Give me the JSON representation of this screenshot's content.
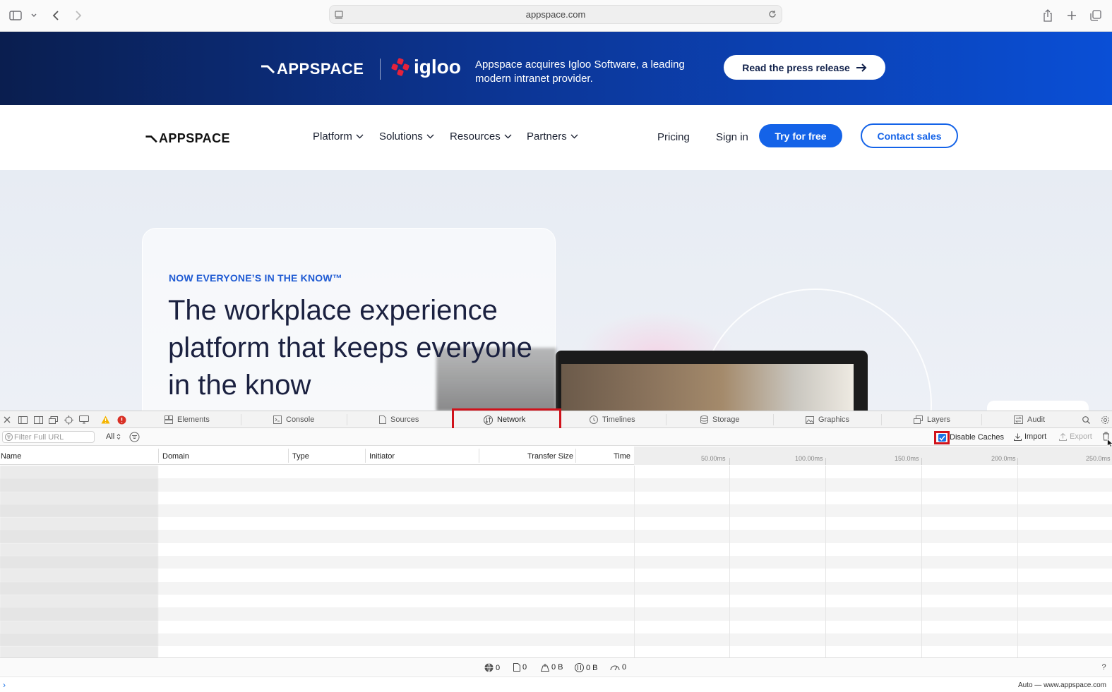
{
  "browser": {
    "url": "appspace.com"
  },
  "banner": {
    "logo_text": "APPSPACE",
    "partner_text": "igloo",
    "message": "Appspace acquires Igloo Software, a leading modern intranet provider.",
    "cta_label": "Read the press release"
  },
  "nav": {
    "brand": "APPSPACE",
    "menus": [
      "Platform",
      "Solutions",
      "Resources",
      "Partners"
    ],
    "pricing": "Pricing",
    "signin": "Sign in",
    "try_label": "Try for free",
    "contact_label": "Contact sales"
  },
  "hero": {
    "eyebrow": "NOW EVERYONE’S IN THE KNOW™",
    "headline": "The workplace experience platform that keeps everyone in the know"
  },
  "devtools": {
    "tabs": [
      "Elements",
      "Console",
      "Sources",
      "Network",
      "Timelines",
      "Storage",
      "Graphics",
      "Layers",
      "Audit"
    ],
    "active_tab": "Network",
    "filter_placeholder": "Filter Full URL",
    "type_filter": "All",
    "disable_caches_label": "Disable Caches",
    "disable_caches_checked": true,
    "import_label": "Import",
    "export_label": "Export",
    "columns": [
      "Name",
      "Domain",
      "Type",
      "Initiator",
      "Transfer Size",
      "Time"
    ],
    "timeline_ticks": [
      "50.00ms",
      "100.00ms",
      "150.0ms",
      "200.0ms",
      "250.0ms"
    ],
    "status": {
      "requests": "0",
      "resources": "0",
      "transferred": "0 B",
      "size": "0 B",
      "time": "0"
    },
    "context": "Auto — www.appspace.com"
  },
  "colors": {
    "accent": "#1463e8",
    "highlight": "#d0121b",
    "banner_dark": "#0a1e4f"
  }
}
